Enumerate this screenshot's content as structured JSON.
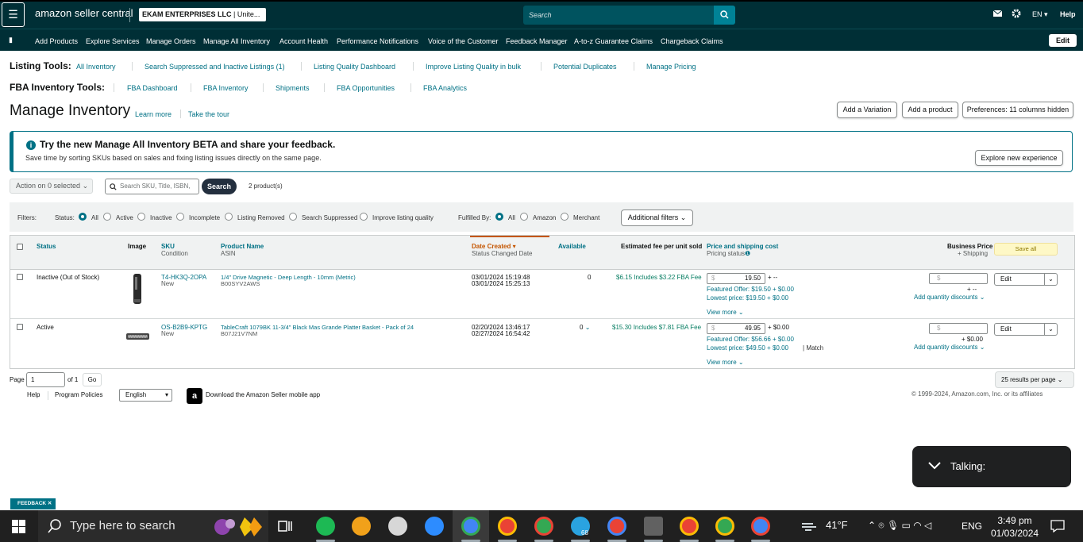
{
  "header": {
    "menu_icon": "hamburger-icon",
    "logo_text": "amazon seller central",
    "store_name": "EKAM ENTERPRISES LLC",
    "store_suffix": "| Unite...",
    "search_placeholder": "Search",
    "lang": "EN",
    "help": "Help"
  },
  "nav": {
    "items": [
      "Add Products",
      "Explore Services",
      "Manage Orders",
      "Manage All Inventory",
      "Account Health",
      "Performance Notifications",
      "Voice of the Customer",
      "Feedback Manager",
      "A-to-z Guarantee Claims",
      "Chargeback Claims"
    ],
    "edit": "Edit"
  },
  "listing_tools": {
    "label": "Listing Tools:",
    "links": [
      "All Inventory",
      "Search Suppressed and Inactive Listings (1)",
      "Listing Quality Dashboard",
      "Improve Listing Quality in bulk",
      "Potential Duplicates",
      "Manage Pricing"
    ]
  },
  "fba_tools": {
    "label": "FBA Inventory Tools:",
    "links": [
      "FBA Dashboard",
      "FBA Inventory",
      "Shipments",
      "FBA Opportunities",
      "FBA Analytics"
    ]
  },
  "page": {
    "title": "Manage Inventory",
    "learn_more": "Learn more",
    "tour": "Take the tour",
    "add_variation": "Add a Variation",
    "add_product": "Add a product",
    "preferences": "Preferences: 11 columns hidden"
  },
  "banner": {
    "title": "Try the new Manage All Inventory BETA and share your feedback.",
    "desc": "Save time by sorting SKUs based on sales and fixing listing issues directly on the same page.",
    "button": "Explore new experience"
  },
  "actions": {
    "action_select": "Action on 0 selected",
    "search_placeholder": "Search SKU, Title, ISBN,",
    "search_button": "Search",
    "count": "2 product(s)"
  },
  "filters": {
    "label": "Filters:",
    "status_label": "Status:",
    "status_options": [
      "All",
      "Active",
      "Inactive",
      "Incomplete",
      "Listing Removed",
      "Search Suppressed",
      "Improve listing quality"
    ],
    "fulfilled_label": "Fulfilled By:",
    "fulfilled_options": [
      "All",
      "Amazon",
      "Merchant"
    ],
    "additional": "Additional filters"
  },
  "table": {
    "headers": {
      "status": "Status",
      "image": "Image",
      "sku": "SKU",
      "condition": "Condition",
      "product_name": "Product Name",
      "asin": "ASIN",
      "date_created": "Date Created",
      "status_changed": "Status Changed Date",
      "available": "Available",
      "fee": "Estimated fee per unit sold",
      "price": "Price and shipping cost",
      "pricing_status": "Pricing status",
      "business_price": "Business Price",
      "shipping": "+ Shipping",
      "save_all": "Save all"
    },
    "rows": [
      {
        "status": "Inactive (Out of Stock)",
        "sku": "T4-HK3Q-2OPA",
        "condition": "New",
        "name": "1/4\" Drive Magnetic - Deep Length - 10mm (Metric)",
        "asin": "B00SYV2AWS",
        "created": "03/01/2024 15:19:48",
        "changed": "03/01/2024 15:25:13",
        "available": "0",
        "fee": "$6.15 Includes $3.22 FBA Fee",
        "price": "19.50",
        "ship": "+ --",
        "featured": "Featured Offer: $19.50 + $0.00",
        "lowest": "Lowest price: $19.50 + $0.00",
        "match": "",
        "view_more": "View more",
        "bp_ship": "+ --",
        "qty_disc": "Add quantity discounts",
        "edit": "Edit"
      },
      {
        "status": "Active",
        "sku": "OS-B2B9-KPTG",
        "condition": "New",
        "name": "TableCraft 1079BK 11-3/4\" Black Mas Grande Platter Basket - Pack of 24",
        "asin": "B07J21V7NM",
        "created": "02/20/2024 13:46:17",
        "changed": "02/27/2024 16:54:42",
        "available": "0",
        "fee": "$15.30 Includes $7.81 FBA Fee",
        "price": "49.95",
        "ship": "+ $0.00",
        "featured": "Featured Offer: $56.66 + $0.00",
        "lowest": "Lowest price: $49.50 + $0.00",
        "match": "Match",
        "view_more": "View more",
        "bp_ship": "+ $0.00",
        "qty_disc": "Add quantity discounts",
        "edit": "Edit"
      }
    ]
  },
  "pagination": {
    "page_label": "Page",
    "page_value": "1",
    "of": "of 1",
    "go": "Go",
    "per_page": "25 results per page"
  },
  "footer": {
    "help": "Help",
    "policies": "Program Policies",
    "language": "English",
    "app": "Download the Amazon Seller mobile app",
    "copyright": "© 1999-2024, Amazon.com, Inc. or its affiliates"
  },
  "toast": {
    "text": "Talking:"
  },
  "feedback": "FEEDBACK ✕",
  "taskbar": {
    "search": "Type here to search",
    "temp": "41°F",
    "lang": "ENG",
    "time": "3:49 pm",
    "date": "01/03/2024",
    "telegram_badge": "68"
  },
  "colors": {
    "header": "#002f36",
    "link": "#007185",
    "taskbar": "#202020"
  }
}
